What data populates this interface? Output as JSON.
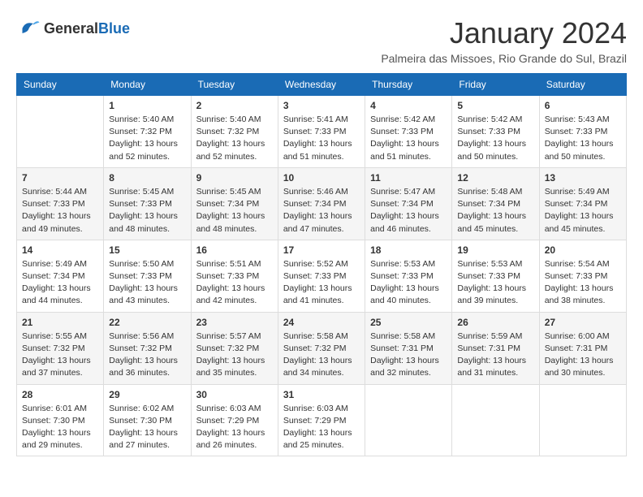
{
  "logo": {
    "general": "General",
    "blue": "Blue"
  },
  "header": {
    "month_title": "January 2024",
    "location": "Palmeira das Missoes, Rio Grande do Sul, Brazil"
  },
  "calendar": {
    "columns": [
      "Sunday",
      "Monday",
      "Tuesday",
      "Wednesday",
      "Thursday",
      "Friday",
      "Saturday"
    ],
    "weeks": [
      [
        null,
        {
          "day": "1",
          "sunrise": "5:40 AM",
          "sunset": "7:32 PM",
          "daylight": "13 hours and 52 minutes."
        },
        {
          "day": "2",
          "sunrise": "5:40 AM",
          "sunset": "7:32 PM",
          "daylight": "13 hours and 52 minutes."
        },
        {
          "day": "3",
          "sunrise": "5:41 AM",
          "sunset": "7:33 PM",
          "daylight": "13 hours and 51 minutes."
        },
        {
          "day": "4",
          "sunrise": "5:42 AM",
          "sunset": "7:33 PM",
          "daylight": "13 hours and 51 minutes."
        },
        {
          "day": "5",
          "sunrise": "5:42 AM",
          "sunset": "7:33 PM",
          "daylight": "13 hours and 50 minutes."
        },
        {
          "day": "6",
          "sunrise": "5:43 AM",
          "sunset": "7:33 PM",
          "daylight": "13 hours and 50 minutes."
        }
      ],
      [
        {
          "day": "7",
          "sunrise": "5:44 AM",
          "sunset": "7:33 PM",
          "daylight": "13 hours and 49 minutes."
        },
        {
          "day": "8",
          "sunrise": "5:45 AM",
          "sunset": "7:33 PM",
          "daylight": "13 hours and 48 minutes."
        },
        {
          "day": "9",
          "sunrise": "5:45 AM",
          "sunset": "7:34 PM",
          "daylight": "13 hours and 48 minutes."
        },
        {
          "day": "10",
          "sunrise": "5:46 AM",
          "sunset": "7:34 PM",
          "daylight": "13 hours and 47 minutes."
        },
        {
          "day": "11",
          "sunrise": "5:47 AM",
          "sunset": "7:34 PM",
          "daylight": "13 hours and 46 minutes."
        },
        {
          "day": "12",
          "sunrise": "5:48 AM",
          "sunset": "7:34 PM",
          "daylight": "13 hours and 45 minutes."
        },
        {
          "day": "13",
          "sunrise": "5:49 AM",
          "sunset": "7:34 PM",
          "daylight": "13 hours and 45 minutes."
        }
      ],
      [
        {
          "day": "14",
          "sunrise": "5:49 AM",
          "sunset": "7:34 PM",
          "daylight": "13 hours and 44 minutes."
        },
        {
          "day": "15",
          "sunrise": "5:50 AM",
          "sunset": "7:33 PM",
          "daylight": "13 hours and 43 minutes."
        },
        {
          "day": "16",
          "sunrise": "5:51 AM",
          "sunset": "7:33 PM",
          "daylight": "13 hours and 42 minutes."
        },
        {
          "day": "17",
          "sunrise": "5:52 AM",
          "sunset": "7:33 PM",
          "daylight": "13 hours and 41 minutes."
        },
        {
          "day": "18",
          "sunrise": "5:53 AM",
          "sunset": "7:33 PM",
          "daylight": "13 hours and 40 minutes."
        },
        {
          "day": "19",
          "sunrise": "5:53 AM",
          "sunset": "7:33 PM",
          "daylight": "13 hours and 39 minutes."
        },
        {
          "day": "20",
          "sunrise": "5:54 AM",
          "sunset": "7:33 PM",
          "daylight": "13 hours and 38 minutes."
        }
      ],
      [
        {
          "day": "21",
          "sunrise": "5:55 AM",
          "sunset": "7:32 PM",
          "daylight": "13 hours and 37 minutes."
        },
        {
          "day": "22",
          "sunrise": "5:56 AM",
          "sunset": "7:32 PM",
          "daylight": "13 hours and 36 minutes."
        },
        {
          "day": "23",
          "sunrise": "5:57 AM",
          "sunset": "7:32 PM",
          "daylight": "13 hours and 35 minutes."
        },
        {
          "day": "24",
          "sunrise": "5:58 AM",
          "sunset": "7:32 PM",
          "daylight": "13 hours and 34 minutes."
        },
        {
          "day": "25",
          "sunrise": "5:58 AM",
          "sunset": "7:31 PM",
          "daylight": "13 hours and 32 minutes."
        },
        {
          "day": "26",
          "sunrise": "5:59 AM",
          "sunset": "7:31 PM",
          "daylight": "13 hours and 31 minutes."
        },
        {
          "day": "27",
          "sunrise": "6:00 AM",
          "sunset": "7:31 PM",
          "daylight": "13 hours and 30 minutes."
        }
      ],
      [
        {
          "day": "28",
          "sunrise": "6:01 AM",
          "sunset": "7:30 PM",
          "daylight": "13 hours and 29 minutes."
        },
        {
          "day": "29",
          "sunrise": "6:02 AM",
          "sunset": "7:30 PM",
          "daylight": "13 hours and 27 minutes."
        },
        {
          "day": "30",
          "sunrise": "6:03 AM",
          "sunset": "7:29 PM",
          "daylight": "13 hours and 26 minutes."
        },
        {
          "day": "31",
          "sunrise": "6:03 AM",
          "sunset": "7:29 PM",
          "daylight": "13 hours and 25 minutes."
        },
        null,
        null,
        null
      ]
    ]
  }
}
